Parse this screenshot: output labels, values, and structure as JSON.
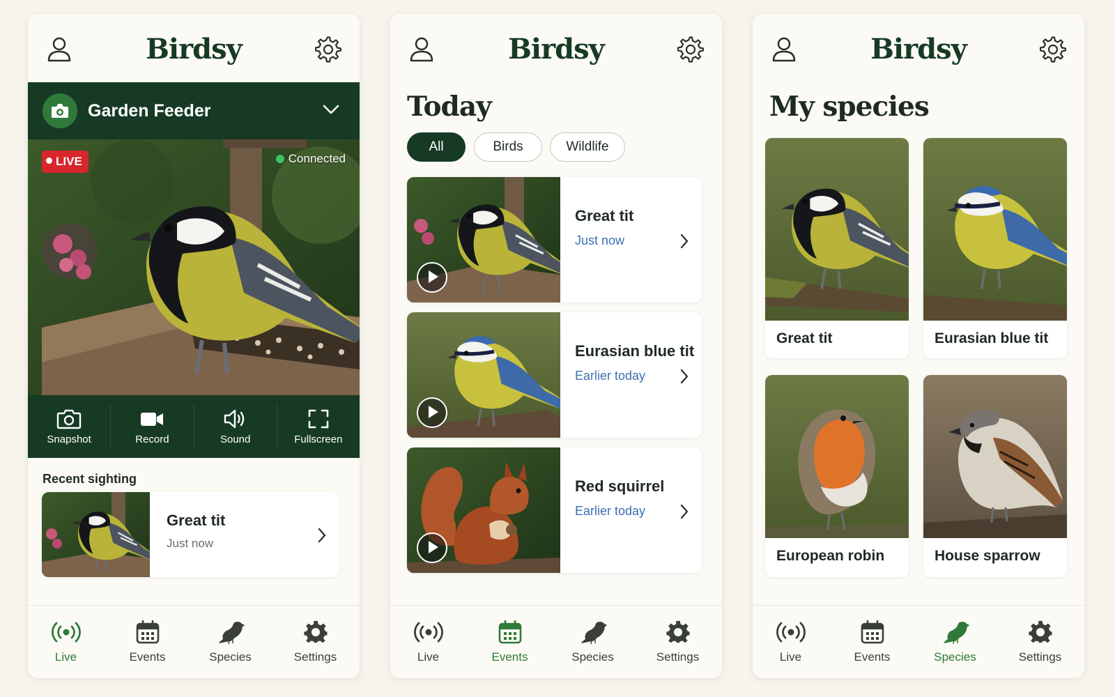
{
  "app": {
    "brand": "Birdsy"
  },
  "colors": {
    "primary_dark": "#173a25",
    "accent_green": "#2f7a3a",
    "live_red": "#d7262c",
    "link_blue": "#3d6fb0",
    "background": "#f6f4ec"
  },
  "live_screen": {
    "camera_name": "Garden Feeder",
    "live_badge": "LIVE",
    "status": "Connected",
    "controls": [
      {
        "label": "Snapshot",
        "icon": "camera-icon"
      },
      {
        "label": "Record",
        "icon": "video-camera-icon"
      },
      {
        "label": "Sound",
        "icon": "speaker-icon"
      },
      {
        "label": "Fullscreen",
        "icon": "fullscreen-icon"
      }
    ],
    "recent_title": "Recent sighting",
    "recent": {
      "name": "Great tit",
      "time": "Just now"
    }
  },
  "events_screen": {
    "title": "Today",
    "filters": [
      {
        "label": "All",
        "active": true
      },
      {
        "label": "Birds",
        "active": false
      },
      {
        "label": "Wildlife",
        "active": false
      }
    ],
    "events": [
      {
        "name": "Great tit",
        "time": "Just now"
      },
      {
        "name": "Eurasian blue tit",
        "time": "Earlier today"
      },
      {
        "name": "Red squirrel",
        "time": "Earlier today"
      }
    ]
  },
  "species_screen": {
    "title": "My species",
    "species": [
      {
        "name": "Great tit"
      },
      {
        "name": "Eurasian blue tit"
      },
      {
        "name": "European robin"
      },
      {
        "name": "House sparrow"
      }
    ]
  },
  "bottom_nav": [
    {
      "label": "Live",
      "icon": "live-broadcast-icon"
    },
    {
      "label": "Events",
      "icon": "calendar-icon"
    },
    {
      "label": "Species",
      "icon": "bird-icon"
    },
    {
      "label": "Settings",
      "icon": "gear-icon"
    }
  ],
  "active_nav": {
    "panel1": "Live",
    "panel2": "Events",
    "panel3": "Species"
  }
}
